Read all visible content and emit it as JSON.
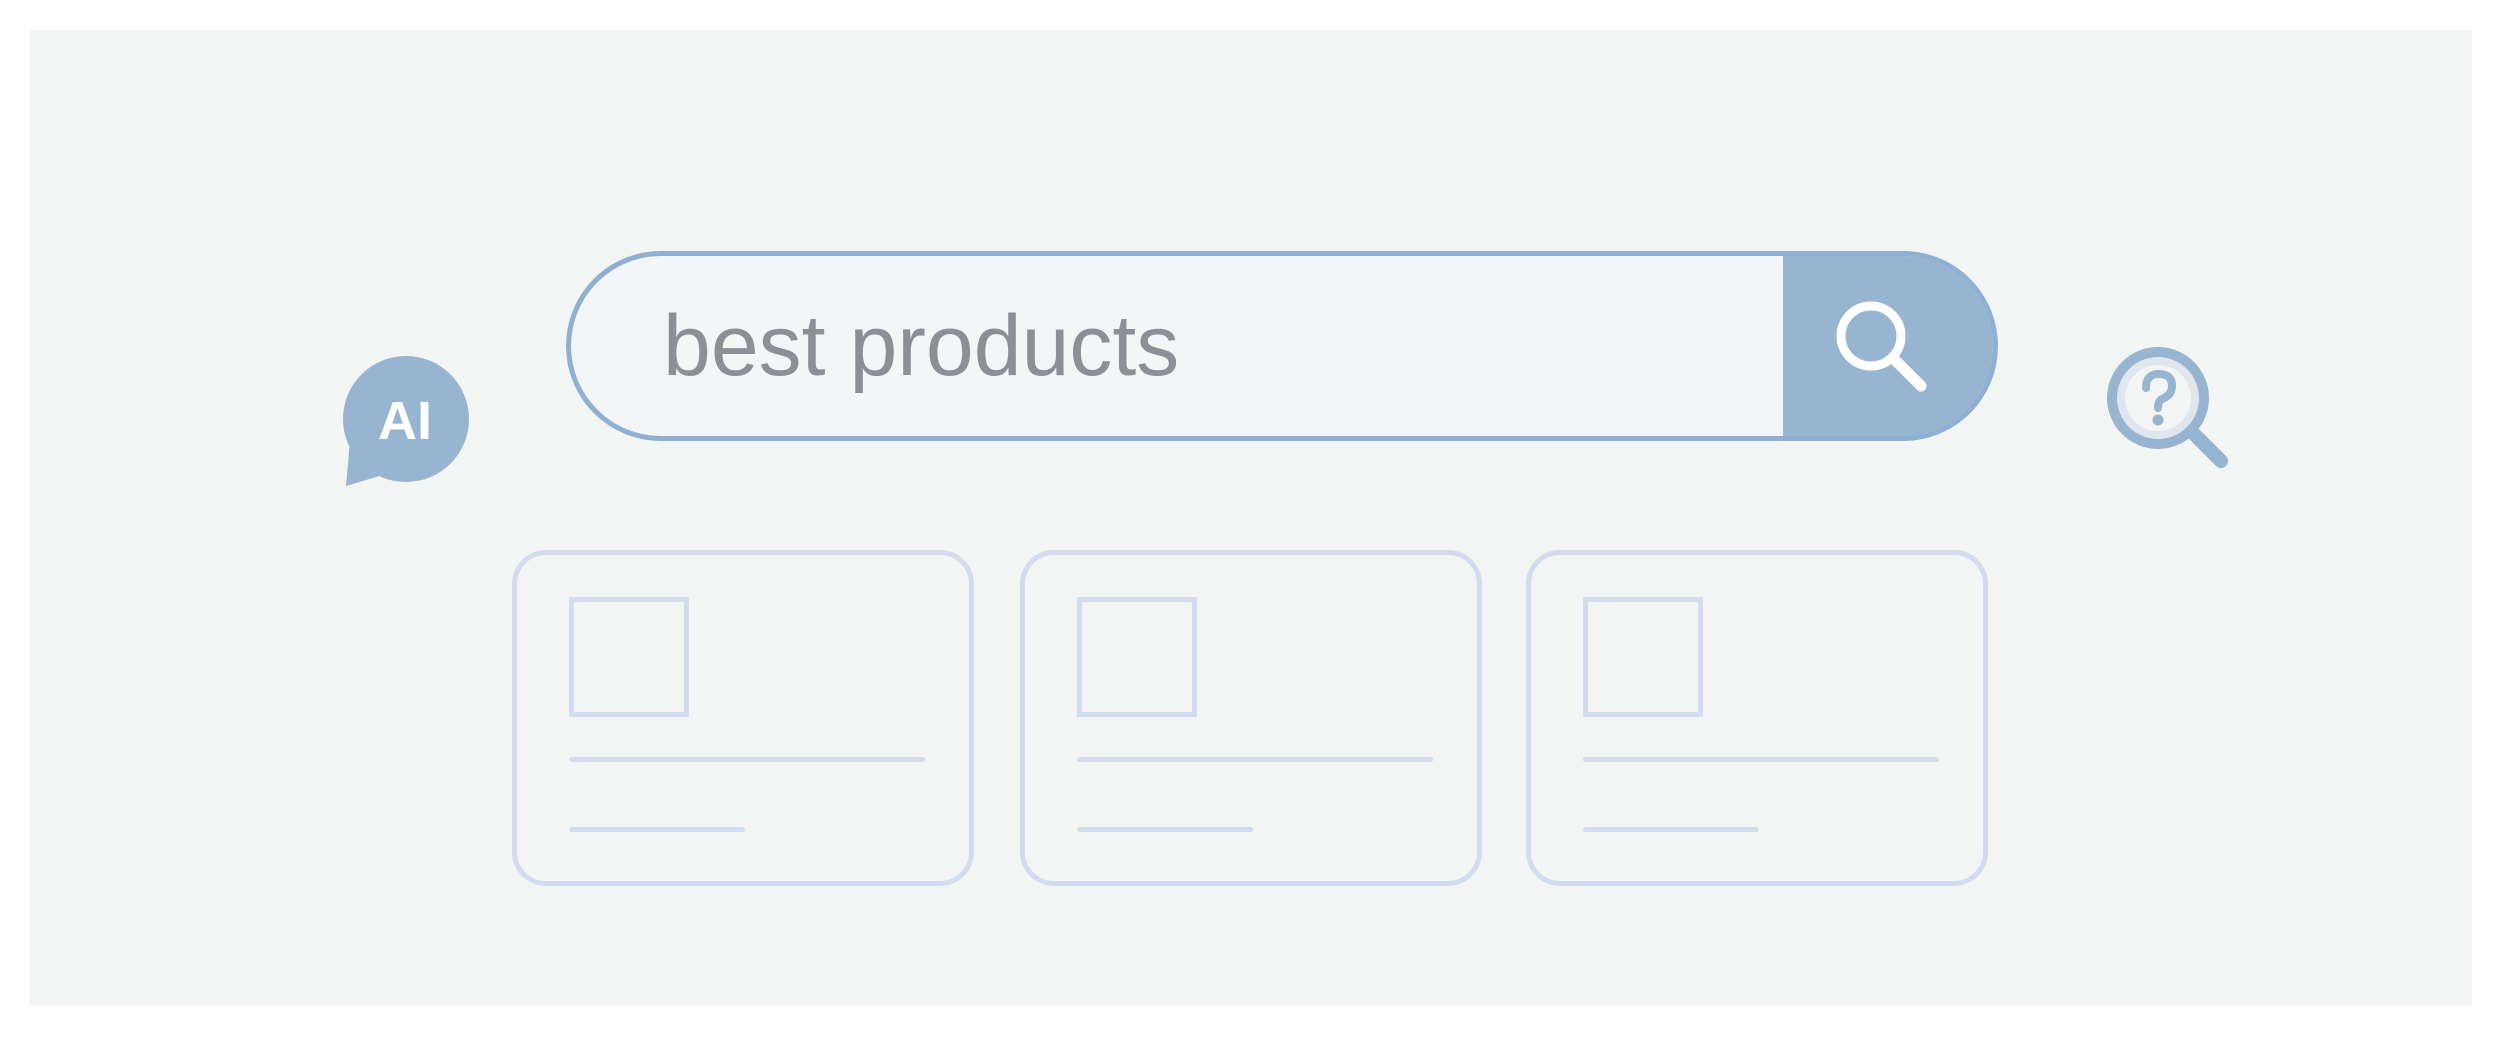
{
  "search": {
    "value": "best products",
    "button_icon": "search-icon"
  },
  "ai_assistant": {
    "label": "AI",
    "icon": "chat-bubble-icon"
  },
  "help": {
    "icon": "question-magnifier-icon"
  },
  "results": {
    "count_shown": 3,
    "items": [
      {
        "thumbnail": "image-placeholder",
        "title": "",
        "subtitle": ""
      },
      {
        "thumbnail": "image-placeholder",
        "title": "",
        "subtitle": ""
      },
      {
        "thumbnail": "image-placeholder",
        "title": "",
        "subtitle": ""
      }
    ]
  },
  "colors": {
    "background": "#f3f4f4",
    "accent": "#97b4d0",
    "search_border": "#8fb0d2",
    "search_text": "#8b9097",
    "placeholder_lines": "#d3dcee"
  }
}
